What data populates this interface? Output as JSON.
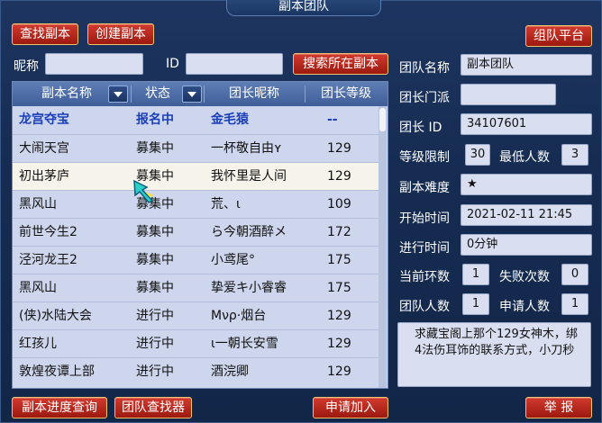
{
  "window": {
    "title": "副本团队"
  },
  "top_buttons": {
    "find": "查找副本",
    "create": "创建副本",
    "platform": "组队平台"
  },
  "search": {
    "nickname_label": "昵称",
    "nickname_value": "",
    "id_label": "ID",
    "id_value": "",
    "search_button": "搜索所在副本"
  },
  "table": {
    "headers": [
      "副本名称",
      "状态",
      "团长昵称",
      "团长等级"
    ],
    "rows": [
      {
        "name": "龙宫夺宝",
        "status": "报名中",
        "leader": "金毛猿",
        "level": "--"
      },
      {
        "name": "大闹天宫",
        "status": "募集中",
        "leader": "一杯敬自由ʏ",
        "level": "129"
      },
      {
        "name": "初出茅庐",
        "status": "募集中",
        "leader": "我怀里是人间",
        "level": "129"
      },
      {
        "name": "黑风山",
        "status": "募集中",
        "leader": "荒、ι",
        "level": "109"
      },
      {
        "name": "前世今生2",
        "status": "募集中",
        "leader": "ら今朝酒醉メ",
        "level": "172"
      },
      {
        "name": "泾河龙王2",
        "status": "募集中",
        "leader": "小鸢尾°",
        "level": "175"
      },
      {
        "name": "黑风山",
        "status": "募集中",
        "leader": "挚爱キ小睿睿",
        "level": "175"
      },
      {
        "name": "(侠)水陆大会",
        "status": "进行中",
        "leader": "Mνρ·烟台",
        "level": "129"
      },
      {
        "name": "红孩儿",
        "status": "进行中",
        "leader": "ι一朝长安雪",
        "level": "129"
      },
      {
        "name": "敦煌夜谭上部",
        "status": "进行中",
        "leader": "酒浣卿",
        "level": "129"
      }
    ]
  },
  "details": {
    "team_name_label": "团队名称",
    "team_name": "副本团队",
    "sect_label": "团长门派",
    "sect": "",
    "leader_id_label": "团长 ID",
    "leader_id": "34107601",
    "level_limit_label": "等级限制",
    "level_limit": "30",
    "min_people_label": "最低人数",
    "min_people": "3",
    "difficulty_label": "副本难度",
    "difficulty": "★",
    "start_time_label": "开始时间",
    "start_time": "2021-02-11 21:45",
    "elapsed_label": "进行时间",
    "elapsed": "0分钟",
    "current_ring_label": "当前环数",
    "current_ring": "1",
    "fail_count_label": "失败次数",
    "fail_count": "0",
    "team_count_label": "团队人数",
    "team_count": "1",
    "apply_count_label": "申请人数",
    "apply_count": "1",
    "description": "求藏宝阁上那个129女神木，绑4法伤耳饰的联系方式，小刀秒"
  },
  "bottom_buttons": {
    "progress": "副本进度查询",
    "finder": "团队查找器",
    "apply": "申请加入",
    "report": "举 报"
  },
  "colors": {
    "button_red": "#c02a1f",
    "button_border": "#f2c26a",
    "panel_blue": "#1d3560",
    "first_row_blue": "#1a3fb8"
  }
}
